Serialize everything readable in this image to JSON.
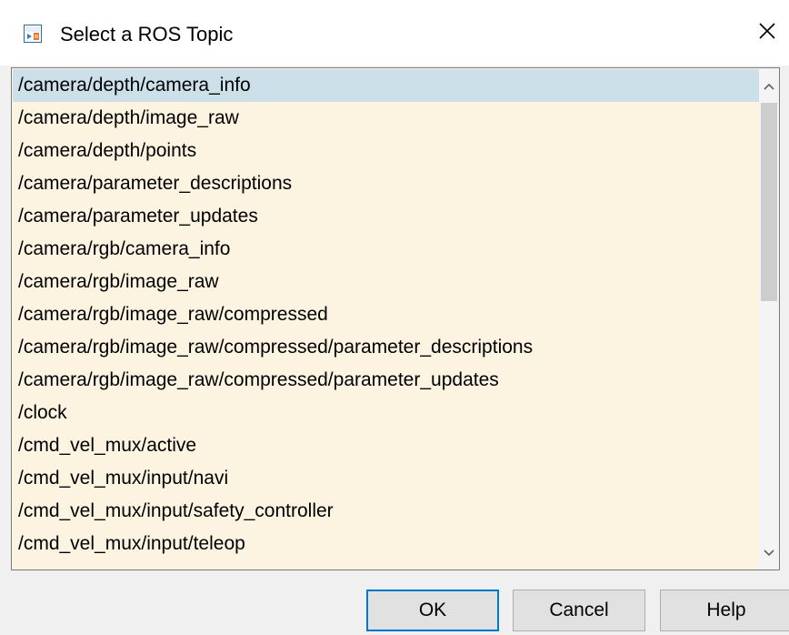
{
  "window": {
    "title": "Select a ROS Topic",
    "close_label": "×"
  },
  "topics": {
    "selected_index": 0,
    "items": [
      "/camera/depth/camera_info",
      "/camera/depth/image_raw",
      "/camera/depth/points",
      "/camera/parameter_descriptions",
      "/camera/parameter_updates",
      "/camera/rgb/camera_info",
      "/camera/rgb/image_raw",
      "/camera/rgb/image_raw/compressed",
      "/camera/rgb/image_raw/compressed/parameter_descriptions",
      "/camera/rgb/image_raw/compressed/parameter_updates",
      "/clock",
      "/cmd_vel_mux/active",
      "/cmd_vel_mux/input/navi",
      "/cmd_vel_mux/input/safety_controller",
      "/cmd_vel_mux/input/teleop"
    ]
  },
  "buttons": {
    "ok": "OK",
    "cancel": "Cancel",
    "help": "Help"
  },
  "colors": {
    "list_background": "#fdf3e1",
    "selection": "#cce0ea",
    "default_button_border": "#0078d7"
  },
  "icons": {
    "title": "simulink-block-icon",
    "close": "close-icon",
    "scroll_up": "chevron-up-icon",
    "scroll_down": "chevron-down-icon"
  }
}
